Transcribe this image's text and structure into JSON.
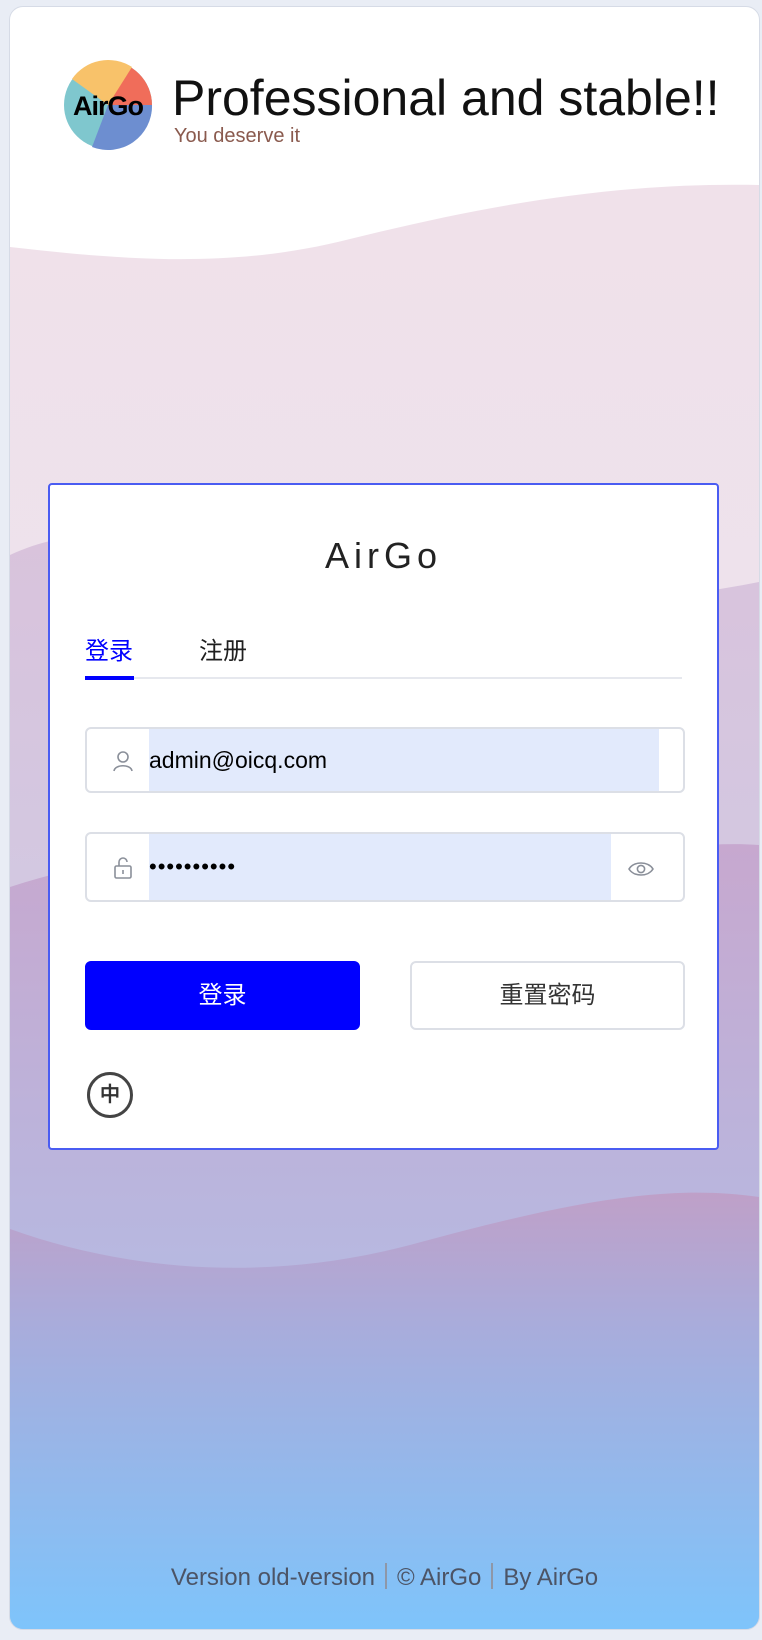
{
  "header": {
    "logo_text": "AirGo",
    "title": "Professional and stable!!",
    "subtitle": "You deserve it"
  },
  "card": {
    "title": "AirGo",
    "tabs": [
      {
        "label": "登录",
        "active": true
      },
      {
        "label": "注册",
        "active": false
      }
    ],
    "email": {
      "value": "admin@oicq.com"
    },
    "password": {
      "value": "••••••••••"
    },
    "login_button": "登录",
    "reset_button": "重置密码",
    "language": "中"
  },
  "footer": {
    "version": "Version old-version",
    "copyright": "© AirGo",
    "by": "By AirGo"
  },
  "colors": {
    "accent": "#0000ff",
    "card_border": "#4a5cf2",
    "input_fill": "#e2eafc"
  }
}
